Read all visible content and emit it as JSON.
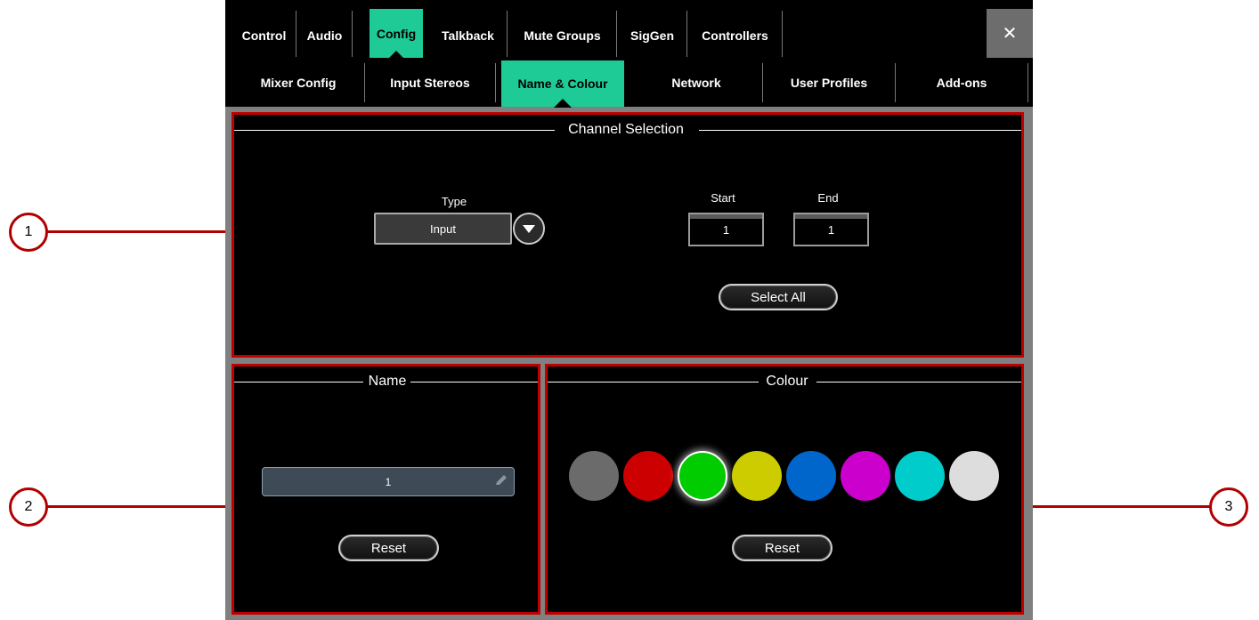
{
  "tabs": [
    {
      "label": "Control",
      "active": false
    },
    {
      "label": "Audio",
      "active": false
    },
    {
      "label": "Config",
      "active": true
    },
    {
      "label": "Talkback",
      "active": false
    },
    {
      "label": "Mute Groups",
      "active": false
    },
    {
      "label": "SigGen",
      "active": false
    },
    {
      "label": "Controllers",
      "active": false
    }
  ],
  "close_label": "✕",
  "subtabs": [
    {
      "label": "Mixer Config",
      "active": false
    },
    {
      "label": "Input Stereos",
      "active": false
    },
    {
      "label": "Name & Colour",
      "active": true
    },
    {
      "label": "Network",
      "active": false
    },
    {
      "label": "User Profiles",
      "active": false
    },
    {
      "label": "Add-ons",
      "active": false
    }
  ],
  "channel_selection": {
    "title": "Channel Selection",
    "type_label": "Type",
    "type_value": "Input",
    "start_label": "Start",
    "start_value": "1",
    "end_label": "End",
    "end_value": "1",
    "select_all_label": "Select All"
  },
  "name_panel": {
    "title": "Name",
    "name_value": "1",
    "reset_label": "Reset"
  },
  "colour_panel": {
    "title": "Colour",
    "swatches": [
      {
        "name": "grey",
        "color": "#6b6b6b",
        "selected": false
      },
      {
        "name": "red",
        "color": "#cc0000",
        "selected": false
      },
      {
        "name": "green",
        "color": "#00cc00",
        "selected": true
      },
      {
        "name": "yellow",
        "color": "#cccc00",
        "selected": false
      },
      {
        "name": "blue",
        "color": "#0066cc",
        "selected": false
      },
      {
        "name": "magenta",
        "color": "#cc00cc",
        "selected": false
      },
      {
        "name": "cyan",
        "color": "#00cccc",
        "selected": false
      },
      {
        "name": "white",
        "color": "#dddddd",
        "selected": false
      }
    ],
    "reset_label": "Reset"
  },
  "callouts": [
    "1",
    "2",
    "3"
  ],
  "colors": {
    "accent": "#1ecb96",
    "highlight": "#c00000"
  }
}
